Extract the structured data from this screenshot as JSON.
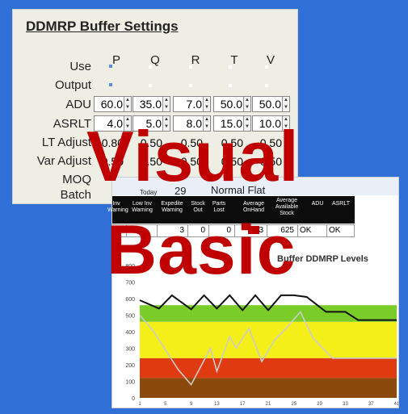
{
  "settings": {
    "title": "DDMRP Buffer Settings",
    "columns": [
      "P",
      "Q",
      "R",
      "T",
      "V"
    ],
    "row_labels": {
      "use": "Use",
      "output": "Output",
      "adu": "ADU",
      "asrlt": "ASRLT",
      "lt_adjust": "LT Adjust",
      "var_adjust": "Var Adjust",
      "moq": "MOQ",
      "batch": "Batch"
    },
    "adu": [
      "60.0",
      "35.0",
      "7.0",
      "50.0",
      "50.0"
    ],
    "asrlt": [
      "4.0",
      "5.0",
      "8.0",
      "15.0",
      "10.0"
    ],
    "lt_adjust": [
      "0.80",
      "0.50",
      "0.50",
      "0.50",
      "0.50"
    ],
    "var_adjust": [
      "0.50",
      "0.50",
      "0.50",
      "0.50",
      "0.50"
    ]
  },
  "sheet": {
    "today_label": "Today",
    "today_value": "29",
    "mode": "Normal Flat",
    "headers": [
      "Inv Warning",
      "Low Inv Warning",
      "Expedite Warning",
      "Stock Out",
      "Parts Lost",
      "Average OnHand",
      "Average Available Stock",
      "ADU",
      "ASRLT"
    ],
    "values": [
      "",
      "",
      "3",
      "0",
      "0",
      "3",
      "625",
      "OK",
      "OK"
    ],
    "chart_title": "Buffer DDMRP Levels"
  },
  "overlay": {
    "word1": "Visual",
    "word2": "Basic"
  },
  "chart_data": {
    "type": "area",
    "title": "Buffer DDMRP Levels",
    "y_ticks": [
      0,
      100,
      200,
      300,
      400,
      500,
      600,
      700,
      800
    ],
    "x_ticks": [
      "1",
      "5",
      "9",
      "13",
      "17",
      "21",
      "25",
      "29",
      "33",
      "37",
      "41"
    ],
    "ylim": [
      0,
      800
    ],
    "zones": [
      {
        "name": "base",
        "from": 0,
        "to": 120,
        "color": "#8b4a0c"
      },
      {
        "name": "red",
        "from": 120,
        "to": 240,
        "color": "#e03a10"
      },
      {
        "name": "yellow",
        "from": 240,
        "to": 460,
        "color": "#f4ef18"
      },
      {
        "name": "green",
        "from": 460,
        "to": 560,
        "color": "#7acc28"
      }
    ],
    "series": [
      {
        "color": "#111111",
        "x": [
          1,
          4,
          6,
          9,
          11,
          13,
          15,
          17,
          19,
          21,
          23,
          25,
          27,
          30,
          33,
          35,
          41
        ],
        "y": [
          590,
          540,
          620,
          535,
          620,
          540,
          620,
          530,
          620,
          530,
          620,
          620,
          610,
          520,
          520,
          470,
          470
        ]
      },
      {
        "color": "#cccccc",
        "x": [
          1,
          3,
          7,
          9,
          12,
          13,
          15,
          16,
          18,
          20,
          22,
          24,
          26,
          28,
          31,
          33,
          41
        ],
        "y": [
          500,
          410,
          170,
          80,
          300,
          160,
          370,
          300,
          420,
          220,
          350,
          430,
          520,
          360,
          240,
          240,
          240
        ]
      }
    ]
  }
}
